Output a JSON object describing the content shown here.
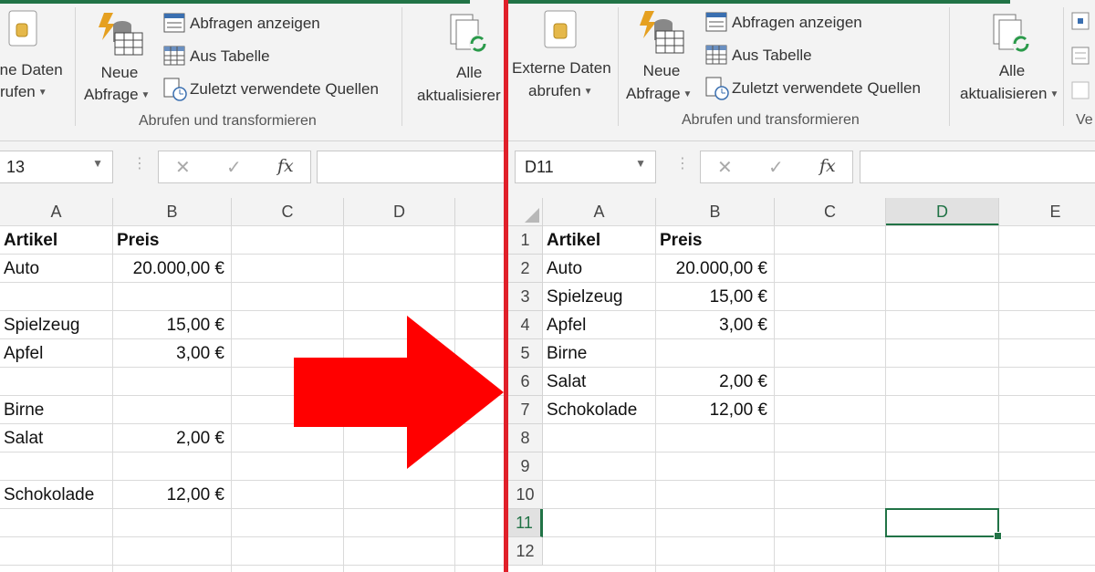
{
  "left": {
    "ribbon": {
      "externe_daten_line1": "rne Daten",
      "externe_daten_line2": "rufen",
      "neue_abfrage_line1": "Neue",
      "neue_abfrage_line2": "Abfrage",
      "abfragen_anzeigen": "Abfragen anzeigen",
      "aus_tabelle": "Aus Tabelle",
      "zuletzt": "Zuletzt verwendete Quellen",
      "group_label": "Abrufen und transformieren",
      "alle_line1": "Alle",
      "alle_line2": "aktualisierer"
    },
    "namebox": "13",
    "columns": [
      "A",
      "B",
      "C",
      "D"
    ],
    "rows": [
      {
        "a": "Artikel",
        "b": "Preis",
        "header": true
      },
      {
        "a": "Auto",
        "b": "20.000,00 €"
      },
      {
        "a": "",
        "b": ""
      },
      {
        "a": "Spielzeug",
        "b": "15,00 €"
      },
      {
        "a": "Apfel",
        "b": "3,00 €"
      },
      {
        "a": "",
        "b": ""
      },
      {
        "a": "Birne",
        "b": ""
      },
      {
        "a": "Salat",
        "b": "2,00 €"
      },
      {
        "a": "",
        "b": ""
      },
      {
        "a": "Schokolade",
        "b": "12,00 €"
      },
      {
        "a": "",
        "b": ""
      },
      {
        "a": "",
        "b": ""
      },
      {
        "a": "",
        "b": ""
      }
    ]
  },
  "right": {
    "ribbon": {
      "externe_daten_line1": "Externe Daten",
      "externe_daten_line2": "abrufen",
      "neue_abfrage_line1": "Neue",
      "neue_abfrage_line2": "Abfrage",
      "abfragen_anzeigen": "Abfragen anzeigen",
      "aus_tabelle": "Aus Tabelle",
      "zuletzt": "Zuletzt verwendete Quellen",
      "group_label": "Abrufen und transformieren",
      "alle_line1": "Alle",
      "alle_line2": "aktualisieren",
      "ve_label": "Ve"
    },
    "namebox": "D11",
    "columns": [
      "A",
      "B",
      "C",
      "D",
      "E"
    ],
    "active_column": "D",
    "active_row": "11",
    "row_numbers": [
      "1",
      "2",
      "3",
      "4",
      "5",
      "6",
      "7",
      "8",
      "9",
      "10",
      "11",
      "12"
    ],
    "rows": [
      {
        "a": "Artikel",
        "b": "Preis",
        "header": true
      },
      {
        "a": "Auto",
        "b": "20.000,00 €"
      },
      {
        "a": "Spielzeug",
        "b": "15,00 €"
      },
      {
        "a": "Apfel",
        "b": "3,00 €"
      },
      {
        "a": "Birne",
        "b": ""
      },
      {
        "a": "Salat",
        "b": "2,00 €"
      },
      {
        "a": "Schokolade",
        "b": "12,00 €"
      },
      {
        "a": "",
        "b": ""
      },
      {
        "a": "",
        "b": ""
      },
      {
        "a": "",
        "b": ""
      },
      {
        "a": "",
        "b": ""
      },
      {
        "a": "",
        "b": ""
      }
    ]
  },
  "formula_icons": {
    "cancel": "✕",
    "enter": "✓",
    "fx": "fx"
  },
  "colors": {
    "accent_green": "#217346",
    "divider_red": "#e0202a",
    "arrow_red": "#ff0000"
  }
}
